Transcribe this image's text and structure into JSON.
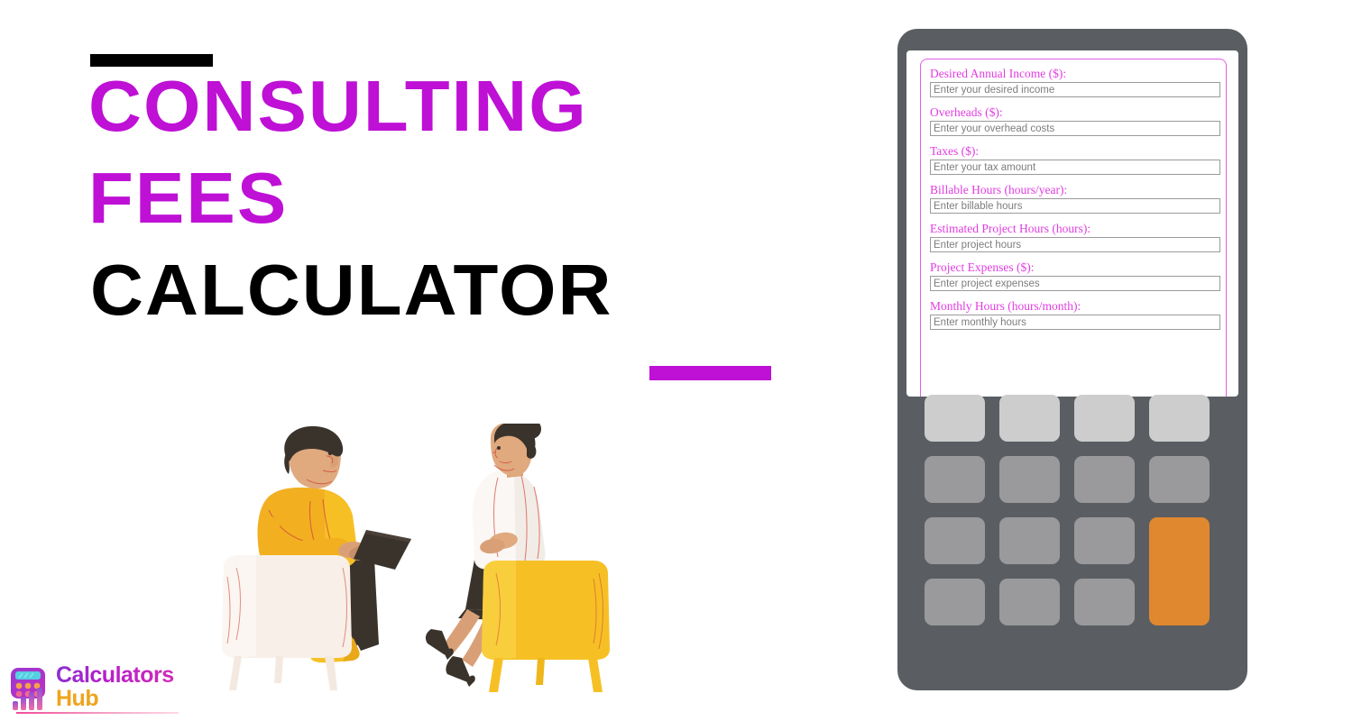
{
  "title": {
    "line1": "CONSULTING",
    "line2": "FEES",
    "line3": "CALCULATOR",
    "accent_color": "#bf10d6",
    "text_color": "#000000"
  },
  "logo": {
    "word1": "Calculators",
    "word2": "Hub",
    "icon": "calculator-bar-chart-icon",
    "word1_color": "#b81fc9",
    "word2_color": "#efa41e"
  },
  "illustration": {
    "name": "two-people-consulting-meeting-illustration",
    "person_left": "man-in-yellow-sweater-with-tablet",
    "person_right": "woman-in-white-blouse",
    "chair_left_color": "#f7efe8",
    "chair_right_color": "#f6c025"
  },
  "calculator": {
    "body_color": "#5a5e62",
    "screen_color": "#ffffff",
    "form_border_color": "#e45ce4",
    "label_color": "#e23ce2",
    "fields": [
      {
        "label": "Desired Annual Income ($):",
        "placeholder": "Enter your desired income",
        "value": ""
      },
      {
        "label": "Overheads ($):",
        "placeholder": "Enter your overhead costs",
        "value": ""
      },
      {
        "label": "Taxes ($):",
        "placeholder": "Enter your tax amount",
        "value": ""
      },
      {
        "label": "Billable Hours (hours/year):",
        "placeholder": "Enter billable hours",
        "value": ""
      },
      {
        "label": "Estimated Project Hours (hours):",
        "placeholder": "Enter project hours",
        "value": ""
      },
      {
        "label": "Project Expenses ($):",
        "placeholder": "Enter project expenses",
        "value": ""
      },
      {
        "label": "Monthly Hours (hours/month):",
        "placeholder": "Enter monthly hours",
        "value": ""
      }
    ],
    "keypad": {
      "light_key_color": "#cdcdcd",
      "mid_key_color": "#9a9a9c",
      "accent_key_color": "#e08830",
      "rows": 4,
      "columns": 4,
      "keys": [
        {
          "label": "",
          "style": "light"
        },
        {
          "label": "",
          "style": "light"
        },
        {
          "label": "",
          "style": "light"
        },
        {
          "label": "",
          "style": "light"
        },
        {
          "label": "",
          "style": "mid"
        },
        {
          "label": "",
          "style": "mid"
        },
        {
          "label": "",
          "style": "mid"
        },
        {
          "label": "",
          "style": "mid"
        },
        {
          "label": "",
          "style": "mid"
        },
        {
          "label": "",
          "style": "mid"
        },
        {
          "label": "",
          "style": "mid"
        },
        {
          "label": "",
          "style": "mid"
        },
        {
          "label": "",
          "style": "mid"
        },
        {
          "label": "",
          "style": "mid"
        },
        {
          "label": "",
          "style": "orange"
        }
      ]
    }
  }
}
